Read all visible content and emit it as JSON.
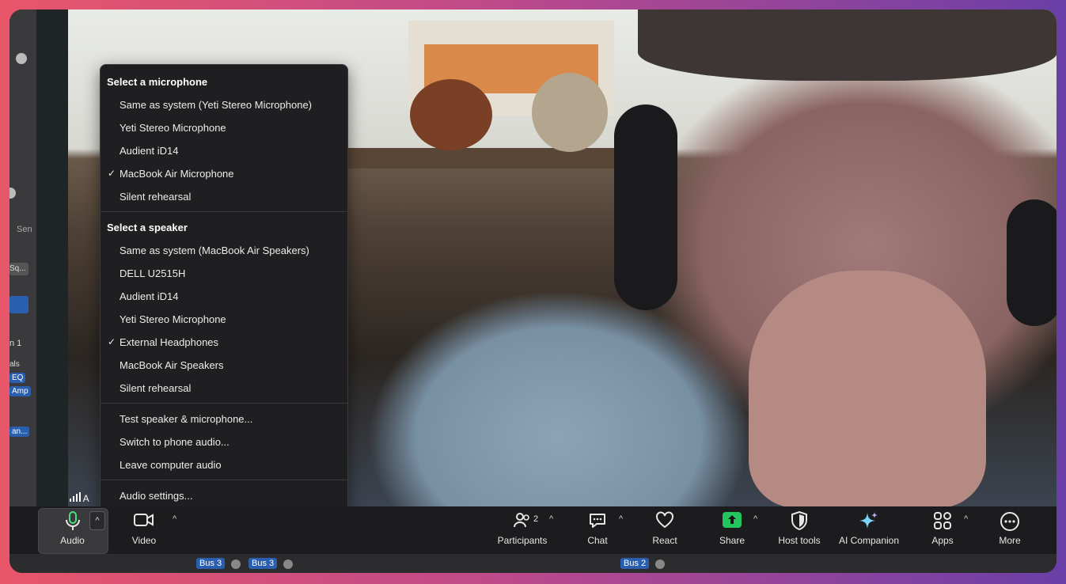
{
  "audio_menu": {
    "mic_header": "Select a microphone",
    "mic_items": [
      {
        "label": "Same as system (Yeti Stereo Microphone)",
        "checked": false
      },
      {
        "label": "Yeti Stereo Microphone",
        "checked": false
      },
      {
        "label": "Audient iD14",
        "checked": false
      },
      {
        "label": "MacBook Air Microphone",
        "checked": true
      },
      {
        "label": "Silent rehearsal",
        "checked": false
      }
    ],
    "speaker_header": "Select a speaker",
    "speaker_items": [
      {
        "label": "Same as system (MacBook Air Speakers)",
        "checked": false
      },
      {
        "label": "DELL U2515H",
        "checked": false
      },
      {
        "label": "Audient iD14",
        "checked": false
      },
      {
        "label": "Yeti Stereo Microphone",
        "checked": false
      },
      {
        "label": "External Headphones",
        "checked": true
      },
      {
        "label": "MacBook Air Speakers",
        "checked": false
      },
      {
        "label": "Silent rehearsal",
        "checked": false
      }
    ],
    "actions": [
      "Test speaker & microphone...",
      "Switch to phone audio...",
      "Leave computer audio"
    ],
    "settings": "Audio settings...",
    "check_glyph": "✓"
  },
  "toolbar": {
    "audio": "Audio",
    "video": "Video",
    "participants": "Participants",
    "participants_count": "2",
    "chat": "Chat",
    "react": "React",
    "share": "Share",
    "host_tools": "Host tools",
    "ai_companion": "AI Companion",
    "apps": "Apps",
    "more": "More",
    "caret": "^"
  },
  "daw": {
    "send": "Sen",
    "sq": "Sq...",
    "in1": "n 1",
    "als": "als",
    "eq": "EQ",
    "amp": "Amp",
    "an": "an...",
    "signal_suffix": "A"
  },
  "mixer": {
    "buses": [
      "Bus 3",
      "Bus 3",
      "Bus 2"
    ]
  },
  "colors": {
    "share_green": "#22c55e",
    "bus_blue": "#2a5fb0",
    "menu_bg": "#1f1f21"
  }
}
